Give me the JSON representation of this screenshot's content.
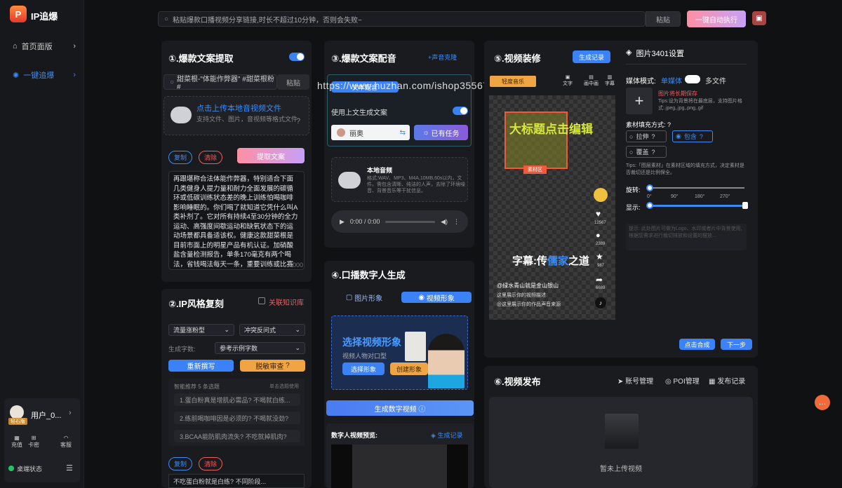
{
  "app": {
    "name": "IP追爆",
    "logo_text": "P"
  },
  "sidebar": {
    "items": [
      {
        "label": "首页面版",
        "chevron": "›"
      },
      {
        "label": "一键追爆",
        "chevron": "›"
      }
    ],
    "user": {
      "name": "用户_0...",
      "badge": "轻石版",
      "chevron": "›"
    },
    "quick": [
      {
        "icon": "grid-icon",
        "label": "充值"
      },
      {
        "icon": "gift-icon",
        "label": "卡密"
      },
      {
        "icon": "headset-icon",
        "label": "客服"
      }
    ],
    "status": "桌端状态"
  },
  "topbar": {
    "search_placeholder": "粘贴爆款口播视频分享链接,时长不超过10分钟，否则会失败~",
    "paste": "粘贴",
    "auto_run": "一键自动执行"
  },
  "p1": {
    "title": "①.爆款文案提取",
    "link_value": "甜菜根-\"体能作弊器\" #甜菜根粉 #",
    "paste": "粘贴",
    "upload_title": "点击上传本地音视频文件",
    "upload_sub": "支持文件、图片，音视频等格式文件",
    "copy": "复制",
    "clear": "清除",
    "extract": "提取文案",
    "text": "再跟堪称合法体能作弊器，特别适合下面几类健身人提力量和耐力全面发展的碳循环或低碳训练状态差的晚上训练怕喝咖啡影响睡眠的。你们喝了就知道它凭什么叫A类补剂了。它对所有持续4至30分钟的全力运动、高强度间歇运动和缺氧状态下的运动场景都具备适该权。健康这款甜菜根是目前市面上的明星产品有机认证。加硝酸盐含量检测报告，单条170毫克有两个喝法，省钱喝法每天一条，重要训练或比赛前两至3个小时来两条，然后步要喝。",
    "counter": "0000"
  },
  "p2": {
    "title": "②.IP风格复刻",
    "kb": "关联知识库",
    "sel1": "流量涨粉型",
    "sel2": "冲突反问式",
    "gen_label": "生成字数:",
    "sel3": "参考示例字数",
    "rewrite": "重新撰写",
    "sensitive": "脱敏审查",
    "smart": "智能推荐 5 条选题",
    "click_use": "单击选题使用",
    "suggestions": [
      "1.蛋白粉真是增肌必需品? 不喝就白练...",
      "2.练前喝咖啡因是必须的? 不喝就没劲?",
      "3.BCAA能防肌肉流失? 不吃就掉肌肉?"
    ],
    "copy": "复制",
    "clear": "清除",
    "bottom_text": "不吃蛋白粉就是白练? 不同阶段..."
  },
  "p3": {
    "title": "③.爆款文案配音",
    "clone": "+声音克隆",
    "tab_active": "文本配音",
    "use_above": "使用上文生成文案",
    "voice": "丽奥",
    "task": "已有任务",
    "local_title": "本地音频",
    "local_sub": "格式:WAV、MP3、M4A,10MB,60s以内，文件。需包含清晰、纯洁的人声，去除了环境噪音、背景音乐等干扰信息。",
    "time": "0:00 / 0:00"
  },
  "watermark": "https://www.huzhan.com/ishop35567",
  "p4": {
    "title": "④.口播数字人生成",
    "tab_image": "图片形象",
    "tab_video": "视频形象",
    "choose_title": "选择视频形象",
    "choose_sub": "视频人物对口型",
    "choose_btn": "选择形象",
    "create_btn": "创建形象",
    "generate": "生成数字视频",
    "preview": "数字人视频预览:",
    "records": "生成记录"
  },
  "p5": {
    "title": "⑤.视频装修",
    "records": "生成记录",
    "tools": [
      {
        "icon": "text-icon",
        "label": "文字"
      },
      {
        "icon": "pip-icon",
        "label": "画中画"
      },
      {
        "icon": "caption-icon",
        "label": "字幕"
      }
    ],
    "tag": "轻度音乐",
    "big_title": "大标题点击编辑",
    "area_label": "素材区",
    "likes": "12567",
    "comments": "2389",
    "stars": "987",
    "shares": "6689",
    "subtitle_pre": "字幕:传",
    "subtitle_hl": "儒家",
    "subtitle_post": "之道",
    "handle": "@绿水青山就是金山银山",
    "desc1": "这里展示你的视频描述",
    "desc2": "@这里展示你的作品声音来源",
    "compose": "点击合成",
    "next": "下一步"
  },
  "settings": {
    "title": "图片3401设置",
    "media_mode": "媒体模式:",
    "single": "单媒体",
    "multi": "多文件",
    "long_press": "图片将长期保存",
    "tips": "Tips:设为背景将在最底层，支持图片格式:.jpeg,.jpg,.png,.gif",
    "fill_label": "素材填充方式:",
    "stretch": "拉伸",
    "contain": "包含",
    "cover": "覆盖",
    "fill_tips": "Tips:「图层素材」在素材区域的填充方式，决定素材是否裁切还是比例保全。",
    "rotate": "旋转:",
    "angles": [
      "0°",
      "90°",
      "180°",
      "270°"
    ],
    "display": "显示:",
    "hint": "提示: 此处图片可做为Logo、水印或者片中背景使用,根据您需求进行裁切排放和设置的摆放..."
  },
  "p6": {
    "title": "⑥.视频发布",
    "account": "账号管理",
    "poi": "POI管理",
    "records": "发布记录",
    "empty": "暂未上传视频"
  }
}
